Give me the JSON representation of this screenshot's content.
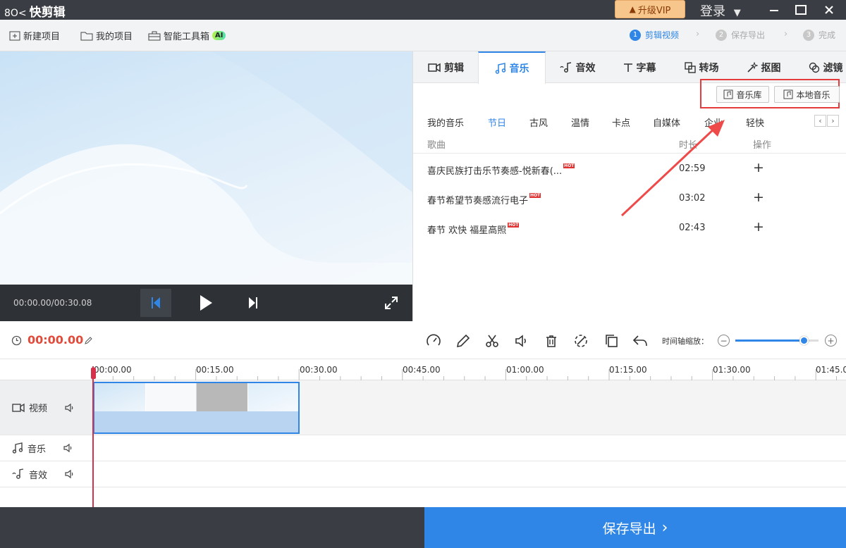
{
  "app": {
    "logo_mark": "8O<",
    "title": "快剪辑",
    "vip_label": "升级VIP",
    "login_label": "登录"
  },
  "toolbar": {
    "new_project": "新建项目",
    "my_projects": "我的项目",
    "smart_toolbox": "智能工具箱",
    "ai_badge": "AI"
  },
  "steps": [
    {
      "num": "1",
      "label": "剪辑视频"
    },
    {
      "num": "2",
      "label": "保存导出"
    },
    {
      "num": "3",
      "label": "完成"
    }
  ],
  "player": {
    "time": "00:00.00/00:30.08"
  },
  "tabs": [
    "剪辑",
    "音乐",
    "音效",
    "字幕",
    "转场",
    "抠图",
    "滤镜"
  ],
  "music": {
    "library_btn": "音乐库",
    "local_btn": "本地音乐",
    "categories": [
      "我的音乐",
      "节日",
      "古风",
      "温情",
      "卡点",
      "自媒体",
      "企业",
      "轻快"
    ],
    "col_song": "歌曲",
    "col_duration": "时长",
    "col_action": "操作",
    "hot_label": "HOT",
    "songs": [
      {
        "title": "喜庆民族打击乐节奏感-悦新春(...",
        "duration": "02:59",
        "action": "+"
      },
      {
        "title": "春节希望节奏感流行电子",
        "duration": "03:02",
        "action": "+"
      },
      {
        "title": "春节 欢快 福星高照",
        "duration": "02:43",
        "action": "+"
      }
    ]
  },
  "timeline": {
    "current_time": "00:00.00",
    "zoom_label": "时间轴缩放：",
    "zoom_level": 0.82,
    "ticks": [
      "00:00.00",
      "00:15.00",
      "00:30.00",
      "00:45.00",
      "01:00.00",
      "01:15.00",
      "01:30.00",
      "01:45.00"
    ],
    "tracks": {
      "video": "视频",
      "music": "音乐",
      "sfx": "音效"
    }
  },
  "save_label": "保存导出",
  "colors": {
    "accent": "#2f86e6",
    "highlight": "#e63b3b",
    "vip": "#f6c68c"
  }
}
